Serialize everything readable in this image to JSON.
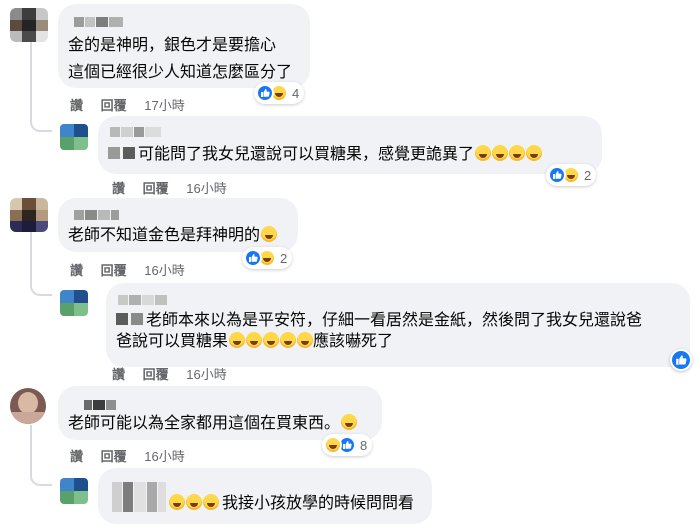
{
  "comments": [
    {
      "text_lines": [
        "金的是神明，銀色才是要擔心",
        "這個已經很少人知道怎麼區分了"
      ],
      "actions": {
        "like": "讚",
        "reply": "回覆",
        "time": "17小時"
      },
      "reaction_count": "4",
      "reactions": [
        "like",
        "haha"
      ]
    },
    {
      "text_lines": [
        "可能問了我女兒還說可以買糖果，感覺更詭異了"
      ],
      "emoji_suffix_count": 4,
      "emoji": "rolling-on-floor-laughing",
      "actions": {
        "like": "讚",
        "reply": "回覆",
        "time": "16小時"
      },
      "reaction_count": "2",
      "reactions": [
        "like",
        "haha"
      ]
    },
    {
      "text_lines": [
        "老師不知道金色是拜神明的"
      ],
      "emoji_suffix_count": 1,
      "emoji": "rolling-on-floor-laughing",
      "actions": {
        "like": "讚",
        "reply": "回覆",
        "time": "16小時"
      },
      "reaction_count": "2",
      "reactions": [
        "like",
        "haha"
      ]
    },
    {
      "text_lines": [
        "老師本來以為是平安符，仔細一看居然是金紙，然後問了我女兒還說爸",
        "爸說可以買糖果",
        "應該嚇死了"
      ],
      "emoji_inline_count": 5,
      "emoji": "rolling-on-floor-laughing",
      "actions": {
        "like": "讚",
        "reply": "回覆",
        "time": "16小時"
      },
      "reactions": [
        "like"
      ]
    },
    {
      "text_lines": [
        "老師可能以為全家都用這個在買東西。"
      ],
      "emoji_suffix_count": 1,
      "emoji": "grinning-sweat",
      "actions": {
        "like": "讚",
        "reply": "回覆",
        "time": "16小時"
      },
      "reaction_count": "8",
      "reactions": [
        "haha",
        "like"
      ]
    },
    {
      "text_lines": [
        "我接小孩放學的時候問問看"
      ],
      "emoji_prefix_count": 3,
      "emoji": "rolling-on-floor-laughing"
    }
  ],
  "colors": {
    "bubble": "#f0f2f5",
    "like_blue": "#1877f2",
    "meta_gray": "#65676b",
    "thread_line": "#d8dade"
  }
}
